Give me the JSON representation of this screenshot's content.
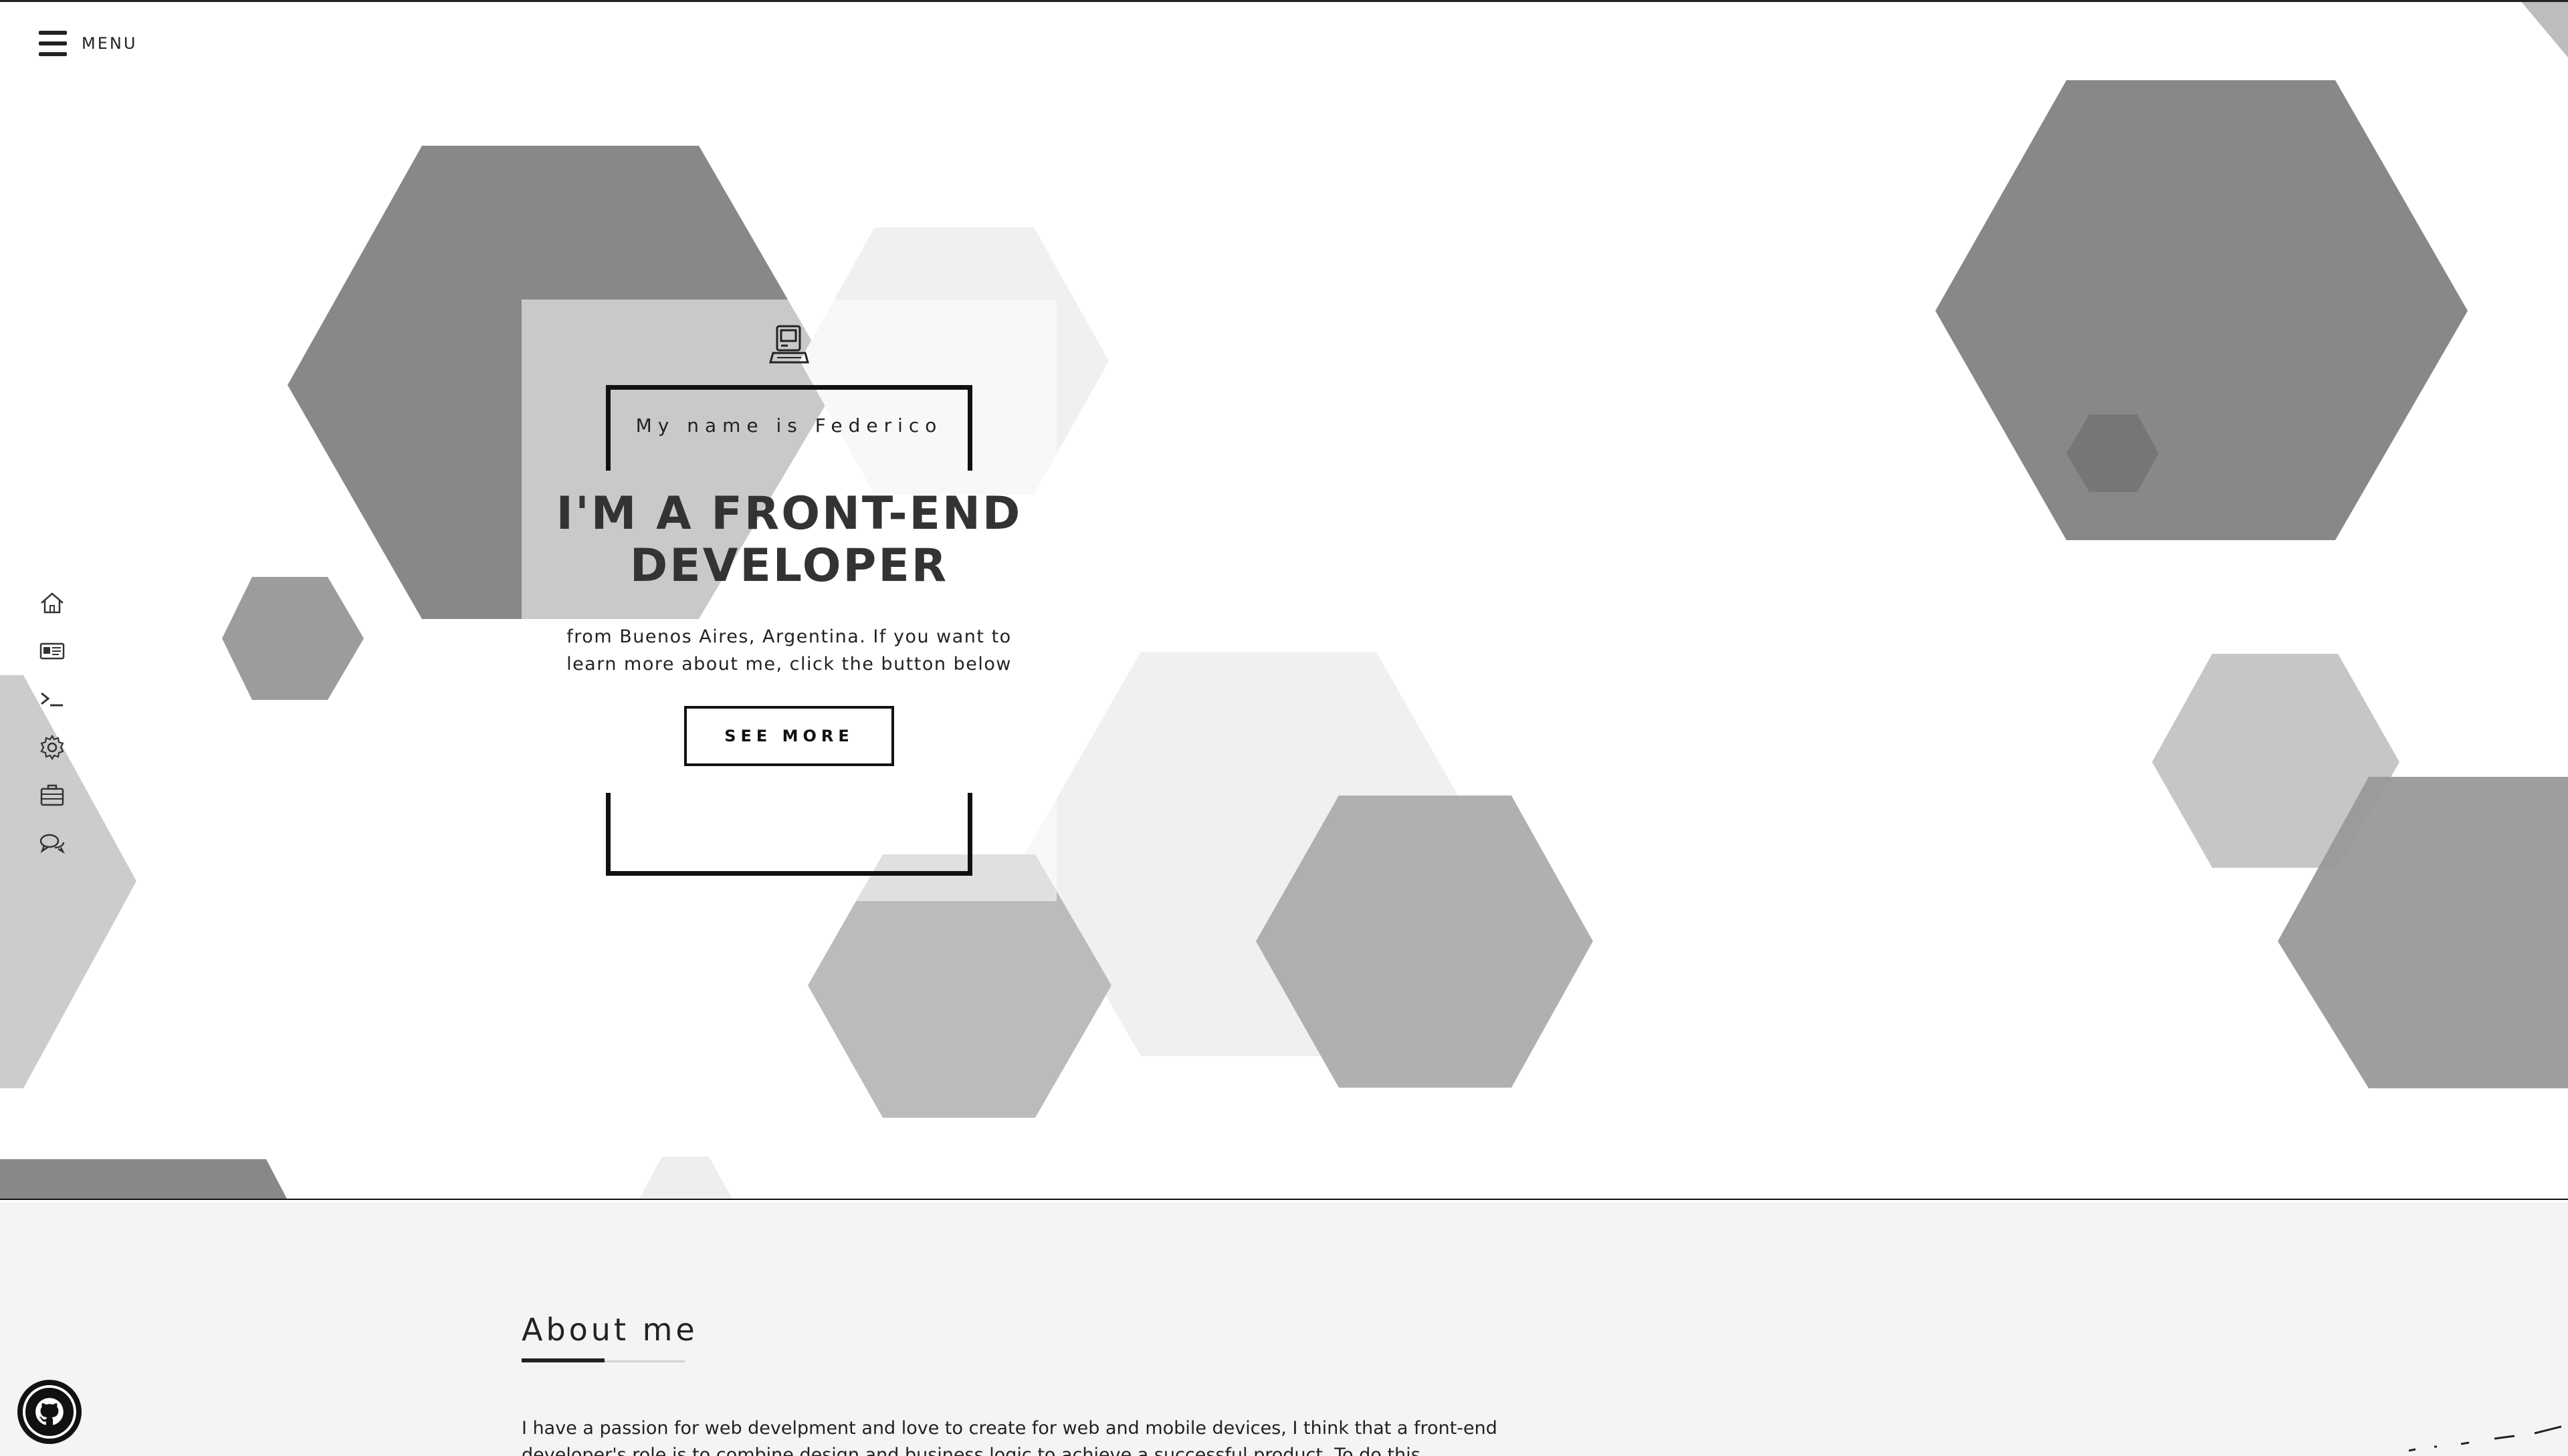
{
  "menu": {
    "label": "MENU"
  },
  "side_nav": {
    "items": [
      {
        "icon": "home-icon"
      },
      {
        "icon": "id-card-icon"
      },
      {
        "icon": "terminal-icon"
      },
      {
        "icon": "gear-icon"
      },
      {
        "icon": "briefcase-icon"
      },
      {
        "icon": "chat-bubbles-icon"
      }
    ]
  },
  "hero": {
    "icon": "computer-icon",
    "tagline": "My name is Federico",
    "title_line1": "I'M A FRONT-END",
    "title_line2": "DEVELOPER",
    "subtitle": "from Buenos Aires, Argentina. If you want to learn more about me, click the button below",
    "button_label": "SEE MORE"
  },
  "about": {
    "title": "About me",
    "paragraph_line1": "I have a passion for web develpment and love to create for web and mobile devices, I think that a front-end",
    "paragraph_line2": "developer's role is to combine design and business logic to achieve a successful product. To do this..."
  },
  "github": {
    "icon": "github-icon"
  },
  "colors": {
    "hex_dark": "#888888",
    "hex_mid": "#a9a9a9",
    "hex_light": "#c6c6c6",
    "hex_faint": "#efefef",
    "text": "#222222",
    "about_bg": "#f4f4f4"
  }
}
